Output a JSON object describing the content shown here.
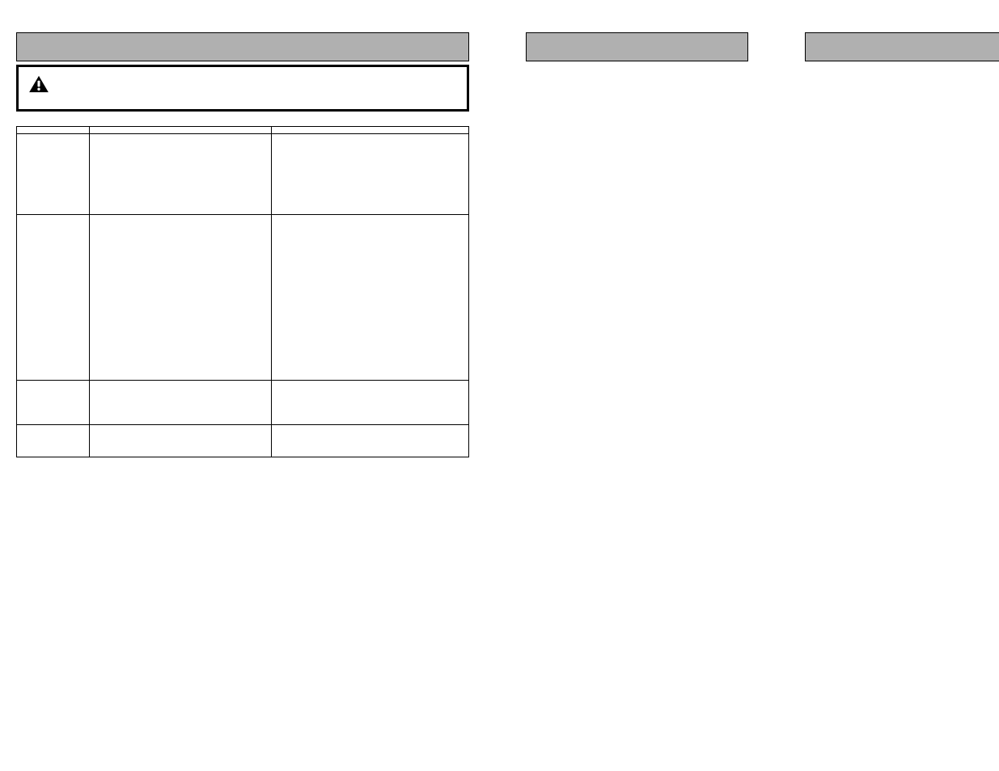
{
  "col1": {
    "section_title": "",
    "caution_title": "",
    "caution_body": "",
    "intro": "",
    "table": {
      "headers": [
        "",
        "",
        ""
      ],
      "rows": [
        {
          "qty": "",
          "pn": "",
          "desc": ""
        },
        {
          "qty": "",
          "pn": "",
          "desc": ""
        },
        {
          "qty": "",
          "pn": "",
          "desc": ""
        },
        {
          "qty": "",
          "pn": "",
          "desc": ""
        }
      ]
    }
  },
  "col2": {
    "section_title": ""
  },
  "col3": {
    "section_title": ""
  }
}
